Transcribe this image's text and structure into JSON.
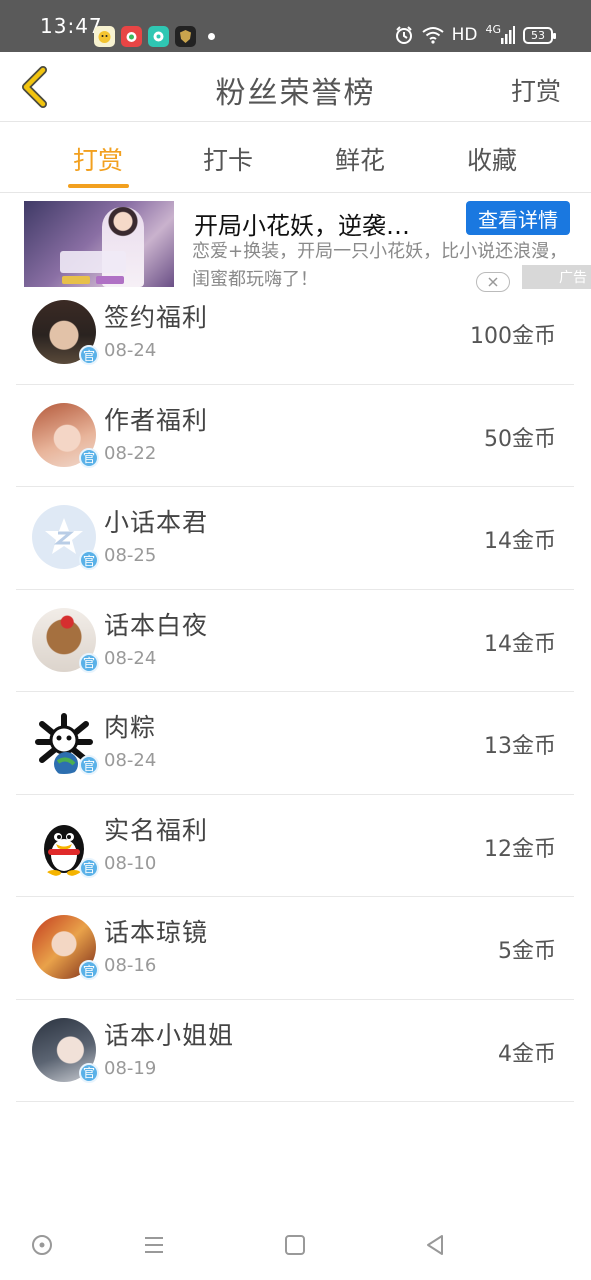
{
  "status_bar": {
    "time": "13:47",
    "network": "HD",
    "signal": "4G",
    "battery": "53"
  },
  "header": {
    "title": "粉丝荣誉榜",
    "right_action": "打赏"
  },
  "tabs": [
    {
      "label": "打赏",
      "active": true
    },
    {
      "label": "打卡",
      "active": false
    },
    {
      "label": "鲜花",
      "active": false
    },
    {
      "label": "收藏",
      "active": false
    }
  ],
  "ad": {
    "title": "开局小花妖，逆袭…",
    "button": "查看详情",
    "description": "恋爱+换装，开局一只小花妖，比小说还浪漫，闺蜜都玩嗨了！",
    "badge": "广告"
  },
  "badge_label": "官",
  "rows": [
    {
      "name": "签约福利",
      "date": "08-24",
      "amount": "100金币"
    },
    {
      "name": "作者福利",
      "date": "08-22",
      "amount": "50金币"
    },
    {
      "name": "小话本君",
      "date": "08-25",
      "amount": "14金币"
    },
    {
      "name": "话本白夜",
      "date": "08-24",
      "amount": "14金币"
    },
    {
      "name": "肉粽",
      "date": "08-24",
      "amount": "13金币"
    },
    {
      "name": "实名福利",
      "date": "08-10",
      "amount": "12金币"
    },
    {
      "name": "话本琼镜",
      "date": "08-16",
      "amount": "5金币"
    },
    {
      "name": "话本小姐姐",
      "date": "08-19",
      "amount": "4金币"
    }
  ],
  "colors": {
    "accent": "#f2a01f",
    "ad_button": "#1a78e0",
    "official_badge": "#59b1e8"
  }
}
